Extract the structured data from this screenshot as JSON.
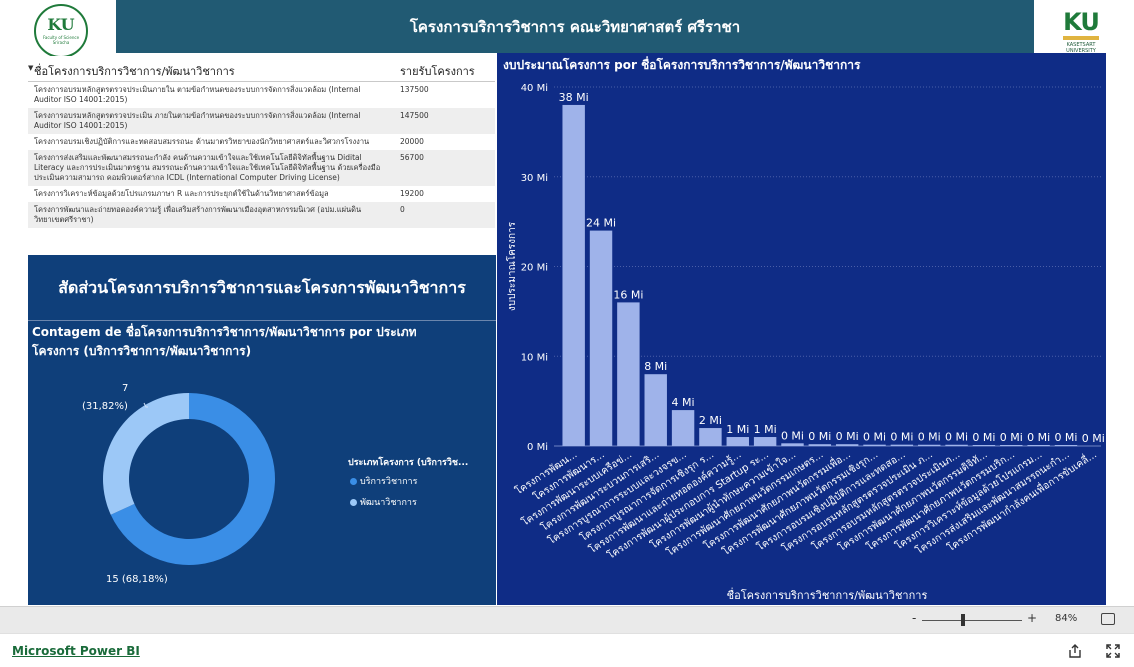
{
  "header": {
    "title": "โครงการบริการวิชาการ คณะวิทยาศาสตร์ ศรีราชา",
    "left_logo_text": "KU",
    "left_logo_sub": "Faculty of Science Sriracha",
    "right_logo_text": "KU",
    "right_logo_sub": "KASETSART UNIVERSITY"
  },
  "table": {
    "col1_header": "ชื่อโครงการบริการวิชาการ/พัฒนาวิชาการ",
    "col2_header": "รายรับโครงการ",
    "rows": [
      {
        "name": "โครงการอบรมหลักสูตรตรวจประเมินภายใน ตามข้อกำหนดของระบบการจัดการสิ่งแวดล้อม (Internal Auditor ISO 14001:2015)",
        "value": "137500"
      },
      {
        "name": "โครงการอบรมหลักสูตรตรวจประเมิน ภายในตามข้อกำหนดของระบบการจัดการสิ่งแวดล้อม (Internal Auditor ISO 14001:2015)",
        "value": "147500"
      },
      {
        "name": "โครงการอบรมเชิงปฏิบัติการและทดสอบสมรรถนะ ด้านมาตรวิทยาของนักวิทยาศาสตร์และวิศวกรโรงงาน",
        "value": "20000"
      },
      {
        "name": "โครงการส่งเสริมและพัฒนาสมรรถนะกำลัง คนด้านความเข้าใจและใช้เทคโนโลยีดิจิทัลพื้นฐาน Didital Literacy และการประเมินมาตรฐาน สมรรถนะด้านความเข้าใจและใช้เทคโนโลยีดิจิทัลพื้นฐาน ด้วยเครื่องมือประเมินความสามารถ คอมพิวเตอร์สากล ICDL (International Computer Driving License)",
        "value": "56700"
      },
      {
        "name": "โครงการวิเคราะห์ข้อมูลด้วยโปรแกรมภาษา R และการประยุกต์ใช้ในด้านวิทยาศาสตร์ข้อมูล",
        "value": "19200"
      },
      {
        "name": "โครงการพัฒนาและถ่ายทอดองค์ความรู้ เพื่อเสริมสร้างการพัฒนาเมืองอุตสาหกรรมนิเวศ (อปม.แผ่นดิน วิทยาเขตศรีราชา)",
        "value": "0"
      }
    ]
  },
  "donut": {
    "panel_title": "สัดส่วนโครงการบริการวิชาการและโครงการพัฒนาวิชาการ",
    "subtitle": "Contagem de ชื่อโครงการบริการวิชาการ/พัฒนาวิชาการ por ประเภทโครงการ (บริการวิชาการ/พัฒนาวิชาการ)",
    "legend_title": "ประเภทโครงการ (บริการวิช...",
    "label_small_count": "7",
    "label_small_pct": "(31,82%)",
    "label_big": "15 (68,18%)",
    "slices": [
      {
        "name": "บริการวิชาการ",
        "value": 15,
        "color": "#3a8ee6"
      },
      {
        "name": "พัฒนาวิชาการ",
        "value": 7,
        "color": "#9cc8f7"
      }
    ]
  },
  "chart_data": {
    "type": "bar",
    "title": "งบประมาณโครงการ por ชื่อโครงการบริการวิชาการ/พัฒนาวิชาการ",
    "xlabel": "ชื่อโครงการบริการวิชาการ/พัฒนาวิชาการ",
    "ylabel": "งบประมาณโครงการ",
    "ylim": [
      0,
      40
    ],
    "y_ticks": [
      "0 Mi",
      "10 Mi",
      "20 Mi",
      "30 Mi",
      "40 Mi"
    ],
    "bar_color": "#9fb3ea",
    "categories": [
      "โครงการพัฒน...",
      "โครงการพัฒนาร...",
      "โครงการพัฒนาระบบเครือข่...",
      "โครงการพัฒนาระบวนการเสริ...",
      "โครงการบูรณาการระบบและวงจรข...",
      "โครงการบูรณาการจัดการเชิงรุก ร...",
      "โครงการพัฒนาและถ่ายทอดองค์ความรู้...",
      "โครงการพัฒนาผู้ประกอบการ Startup ระ...",
      "โครงการพัฒนาผู้นำทักษะความเข้าใจ...",
      "โครงการพัฒนาศักยภาพนวัตกรรมเกษตร...",
      "โครงการพัฒนาศักยภาพนวัตกรรมเพื่อ...",
      "โครงการพัฒนาศักยภาพนวัตกรรมเชิงรุก...",
      "โครงการอบรมเชิงปฏิบัติการและทดสอ...",
      "โครงการอบรมหลักสูตรตรวจประเมิน ภ...",
      "โครงการอบรมหลักสูตรตรวจประเมินภ...",
      "โครงการพัฒนาศักยภาพนวัตกรรมดิจิทั...",
      "โครงการพัฒนาศักยภาพนวัตกรรมบริก...",
      "โครงการวิเคราะห์ข้อมูลด้วยโปรแกรม...",
      "โครงการส่งเสริมและพัฒนาสมรรถนะกำ...",
      "โครงการพัฒนากำลังคนเพื่อการขับเคลื่..."
    ],
    "values": [
      38,
      24,
      16,
      8,
      4,
      2,
      1,
      1,
      0.3,
      0.2,
      0.2,
      0.15,
      0.15,
      0.14,
      0.14,
      0.06,
      0.05,
      0.02,
      0.02,
      0
    ],
    "data_labels": [
      "38 Mi",
      "24 Mi",
      "16 Mi",
      "8 Mi",
      "4 Mi",
      "2 Mi",
      "1 Mi",
      "1 Mi",
      "0 Mi",
      "0 Mi",
      "0 Mi",
      "0 Mi",
      "0 Mi",
      "0 Mi",
      "0 Mi",
      "0 Mi",
      "0 Mi",
      "0 Mi",
      "0 Mi",
      "0 Mi"
    ]
  },
  "zoom": {
    "minus": "-",
    "plus": "+",
    "value": "84%"
  },
  "footer": {
    "brand": "Microsoft Power BI"
  },
  "icons": {
    "share": "share-icon",
    "expand": "expand-icon",
    "fit": "fit-to-page-icon"
  }
}
